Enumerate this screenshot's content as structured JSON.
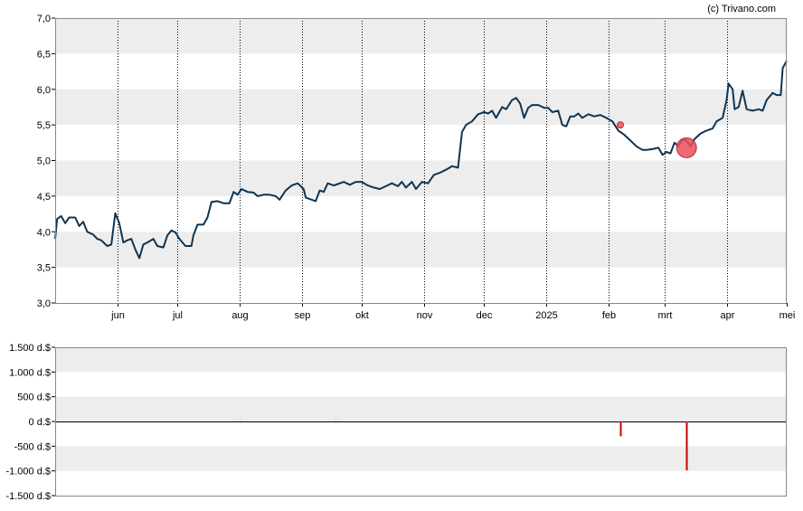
{
  "credit": "(c) Trivano.com",
  "colors": {
    "price_line": "#0f3552",
    "band": "#ededed",
    "marker": "#e8505b",
    "volume_bar": "#cc0000",
    "gridline": "#000000"
  },
  "chart_data": [
    {
      "type": "line",
      "name": "price",
      "ylim": [
        3.0,
        7.0
      ],
      "yticks": [
        "3,0",
        "3,5",
        "4,0",
        "4,5",
        "5,0",
        "5,5",
        "6,0",
        "6,5",
        "7,0"
      ],
      "ytick_values": [
        3.0,
        3.5,
        4.0,
        4.5,
        5.0,
        5.5,
        6.0,
        6.5,
        7.0
      ],
      "xlim": [
        "2024-05-01",
        "2025-05-01"
      ],
      "xticks": [
        "jun",
        "jul",
        "aug",
        "sep",
        "okt",
        "nov",
        "dec",
        "2025",
        "feb",
        "mrt",
        "apr",
        "mei"
      ],
      "xtick_dates": [
        "2024-06-01",
        "2024-07-01",
        "2024-08-01",
        "2024-09-01",
        "2024-10-01",
        "2024-11-01",
        "2024-12-01",
        "2025-01-01",
        "2025-02-01",
        "2025-03-01",
        "2025-04-01",
        "2025-05-01"
      ],
      "grid": "vertical dotted at month ticks, horizontal alternating bands",
      "points": [
        [
          "2024-05-01",
          3.9
        ],
        [
          "2024-05-02",
          4.18
        ],
        [
          "2024-05-04",
          4.22
        ],
        [
          "2024-05-06",
          4.12
        ],
        [
          "2024-05-08",
          4.2
        ],
        [
          "2024-05-11",
          4.2
        ],
        [
          "2024-05-13",
          4.08
        ],
        [
          "2024-05-15",
          4.14
        ],
        [
          "2024-05-17",
          4.0
        ],
        [
          "2024-05-20",
          3.96
        ],
        [
          "2024-05-22",
          3.9
        ],
        [
          "2024-05-24",
          3.88
        ],
        [
          "2024-05-27",
          3.8
        ],
        [
          "2024-05-29",
          3.82
        ],
        [
          "2024-05-31",
          4.26
        ],
        [
          "2024-06-02",
          4.12
        ],
        [
          "2024-06-04",
          3.85
        ],
        [
          "2024-06-06",
          3.88
        ],
        [
          "2024-06-08",
          3.9
        ],
        [
          "2024-06-10",
          3.75
        ],
        [
          "2024-06-12",
          3.63
        ],
        [
          "2024-06-14",
          3.82
        ],
        [
          "2024-06-16",
          3.85
        ],
        [
          "2024-06-19",
          3.9
        ],
        [
          "2024-06-21",
          3.8
        ],
        [
          "2024-06-24",
          3.78
        ],
        [
          "2024-06-26",
          3.95
        ],
        [
          "2024-06-28",
          4.02
        ],
        [
          "2024-06-30",
          3.99
        ],
        [
          "2024-07-02",
          3.9
        ],
        [
          "2024-07-05",
          3.8
        ],
        [
          "2024-07-08",
          3.8
        ],
        [
          "2024-07-09",
          3.95
        ],
        [
          "2024-07-11",
          4.1
        ],
        [
          "2024-07-14",
          4.1
        ],
        [
          "2024-07-16",
          4.2
        ],
        [
          "2024-07-18",
          4.42
        ],
        [
          "2024-07-21",
          4.43
        ],
        [
          "2024-07-24",
          4.4
        ],
        [
          "2024-07-27",
          4.4
        ],
        [
          "2024-07-29",
          4.56
        ],
        [
          "2024-07-31",
          4.52
        ],
        [
          "2024-08-02",
          4.6
        ],
        [
          "2024-08-05",
          4.56
        ],
        [
          "2024-08-08",
          4.55
        ],
        [
          "2024-08-10",
          4.5
        ],
        [
          "2024-08-13",
          4.52
        ],
        [
          "2024-08-16",
          4.52
        ],
        [
          "2024-08-19",
          4.5
        ],
        [
          "2024-08-21",
          4.45
        ],
        [
          "2024-08-24",
          4.58
        ],
        [
          "2024-08-27",
          4.65
        ],
        [
          "2024-08-30",
          4.68
        ],
        [
          "2024-09-02",
          4.6
        ],
        [
          "2024-09-03",
          4.48
        ],
        [
          "2024-09-06",
          4.45
        ],
        [
          "2024-09-08",
          4.43
        ],
        [
          "2024-09-10",
          4.58
        ],
        [
          "2024-09-12",
          4.56
        ],
        [
          "2024-09-14",
          4.68
        ],
        [
          "2024-09-17",
          4.65
        ],
        [
          "2024-09-19",
          4.67
        ],
        [
          "2024-09-22",
          4.7
        ],
        [
          "2024-09-25",
          4.66
        ],
        [
          "2024-09-28",
          4.7
        ],
        [
          "2024-10-01",
          4.7
        ],
        [
          "2024-10-04",
          4.65
        ],
        [
          "2024-10-07",
          4.62
        ],
        [
          "2024-10-10",
          4.6
        ],
        [
          "2024-10-13",
          4.64
        ],
        [
          "2024-10-16",
          4.68
        ],
        [
          "2024-10-19",
          4.64
        ],
        [
          "2024-10-21",
          4.7
        ],
        [
          "2024-10-23",
          4.62
        ],
        [
          "2024-10-26",
          4.7
        ],
        [
          "2024-10-28",
          4.6
        ],
        [
          "2024-10-31",
          4.7
        ],
        [
          "2024-11-03",
          4.68
        ],
        [
          "2024-11-06",
          4.8
        ],
        [
          "2024-11-09",
          4.83
        ],
        [
          "2024-11-12",
          4.87
        ],
        [
          "2024-11-15",
          4.92
        ],
        [
          "2024-11-18",
          4.9
        ],
        [
          "2024-11-20",
          5.4
        ],
        [
          "2024-11-22",
          5.5
        ],
        [
          "2024-11-25",
          5.55
        ],
        [
          "2024-11-28",
          5.65
        ],
        [
          "2024-12-01",
          5.68
        ],
        [
          "2024-12-03",
          5.66
        ],
        [
          "2024-12-05",
          5.7
        ],
        [
          "2024-12-07",
          5.6
        ],
        [
          "2024-12-10",
          5.75
        ],
        [
          "2024-12-12",
          5.72
        ],
        [
          "2024-12-15",
          5.85
        ],
        [
          "2024-12-17",
          5.88
        ],
        [
          "2024-12-19",
          5.8
        ],
        [
          "2024-12-21",
          5.6
        ],
        [
          "2024-12-23",
          5.74
        ],
        [
          "2024-12-25",
          5.78
        ],
        [
          "2024-12-28",
          5.78
        ],
        [
          "2024-12-31",
          5.74
        ],
        [
          "2025-01-02",
          5.74
        ],
        [
          "2025-01-04",
          5.68
        ],
        [
          "2025-01-07",
          5.7
        ],
        [
          "2025-01-09",
          5.5
        ],
        [
          "2025-01-11",
          5.48
        ],
        [
          "2025-01-13",
          5.62
        ],
        [
          "2025-01-15",
          5.62
        ],
        [
          "2025-01-17",
          5.66
        ],
        [
          "2025-01-19",
          5.6
        ],
        [
          "2025-01-22",
          5.65
        ],
        [
          "2025-01-25",
          5.62
        ],
        [
          "2025-01-28",
          5.64
        ],
        [
          "2025-01-31",
          5.6
        ],
        [
          "2025-02-03",
          5.55
        ],
        [
          "2025-02-06",
          5.42
        ],
        [
          "2025-02-09",
          5.36
        ],
        [
          "2025-02-12",
          5.28
        ],
        [
          "2025-02-15",
          5.2
        ],
        [
          "2025-02-18",
          5.15
        ],
        [
          "2025-02-20",
          5.15
        ],
        [
          "2025-02-23",
          5.16
        ],
        [
          "2025-02-26",
          5.18
        ],
        [
          "2025-02-28",
          5.08
        ],
        [
          "2025-03-02",
          5.12
        ],
        [
          "2025-03-04",
          5.1
        ],
        [
          "2025-03-06",
          5.25
        ],
        [
          "2025-03-08",
          5.2
        ],
        [
          "2025-03-10",
          5.3
        ],
        [
          "2025-03-12",
          5.28
        ],
        [
          "2025-03-14",
          5.2
        ],
        [
          "2025-03-16",
          5.3
        ],
        [
          "2025-03-19",
          5.38
        ],
        [
          "2025-03-22",
          5.42
        ],
        [
          "2025-03-25",
          5.45
        ],
        [
          "2025-03-27",
          5.55
        ],
        [
          "2025-03-30",
          5.6
        ],
        [
          "2025-04-01",
          5.85
        ],
        [
          "2025-04-02",
          6.08
        ],
        [
          "2025-04-04",
          6.0
        ],
        [
          "2025-04-05",
          5.72
        ],
        [
          "2025-04-07",
          5.75
        ],
        [
          "2025-04-09",
          5.98
        ],
        [
          "2025-04-11",
          5.72
        ],
        [
          "2025-04-14",
          5.7
        ],
        [
          "2025-04-17",
          5.72
        ],
        [
          "2025-04-19",
          5.7
        ],
        [
          "2025-04-21",
          5.85
        ],
        [
          "2025-04-24",
          5.95
        ],
        [
          "2025-04-26",
          5.92
        ],
        [
          "2025-04-28",
          5.92
        ],
        [
          "2025-04-29",
          6.3
        ],
        [
          "2025-05-01",
          6.4
        ]
      ],
      "markers": [
        {
          "date": "2025-02-07",
          "value": 5.5,
          "size": "small"
        },
        {
          "date": "2025-03-12",
          "value": 5.18,
          "size": "large"
        }
      ]
    },
    {
      "type": "bar",
      "name": "insider_trades",
      "ylim": [
        -1500,
        1500
      ],
      "yticks": [
        "-1.500 d.$",
        "-1.000 d.$",
        "-500 d.$",
        "0 d.$",
        "500 d.$",
        "1.000 d.$",
        "1.500 d.$"
      ],
      "ytick_values": [
        -1500,
        -1000,
        -500,
        0,
        500,
        1000,
        1500
      ],
      "xlim": [
        "2024-05-01",
        "2025-05-01"
      ],
      "bars": [
        {
          "date": "2024-08-01",
          "value": 5
        },
        {
          "date": "2024-09-18",
          "value": 5
        },
        {
          "date": "2025-02-07",
          "value": -300
        },
        {
          "date": "2025-03-12",
          "value": -990
        }
      ]
    }
  ]
}
